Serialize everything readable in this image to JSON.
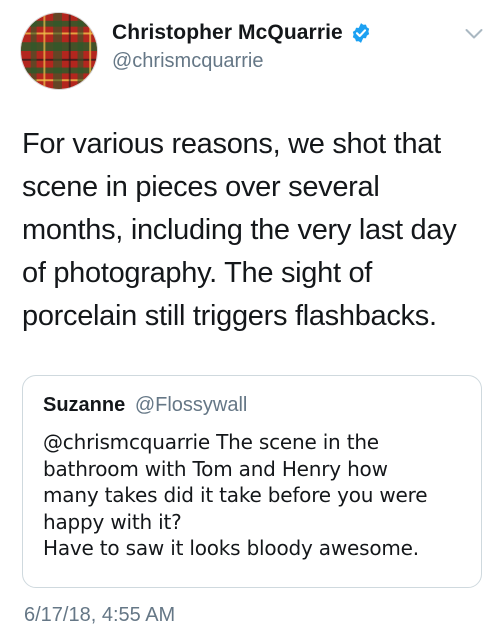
{
  "tweet": {
    "author": {
      "display_name": "Christopher McQuarrie",
      "handle": "@chrismcquarrie",
      "verified": true,
      "avatar_icon": "tartan-plaid-avatar"
    },
    "menu_icon": "chevron-down-icon",
    "text_lines": [
      "For various reasons, we shot that",
      "scene in pieces over several",
      "months, including the very last day",
      "of photography. The sight of",
      "porcelain still triggers flashbacks."
    ],
    "quoted_tweet": {
      "display_name": "Suzanne",
      "handle": "@Flossywall",
      "text_lines": [
        "@chrismcquarrie The scene in the",
        "bathroom with Tom and Henry how",
        "many takes did it take before you were",
        "happy with it?",
        "Have to saw it looks bloody awesome."
      ]
    },
    "timestamp": "6/17/18, 4:55 AM"
  },
  "colors": {
    "text_primary": "#14171a",
    "text_secondary": "#657786",
    "verified_blue": "#1da1f2",
    "card_border": "#cfd9de",
    "avatar_red": "#b3261e",
    "avatar_green": "#2f5a2a"
  }
}
